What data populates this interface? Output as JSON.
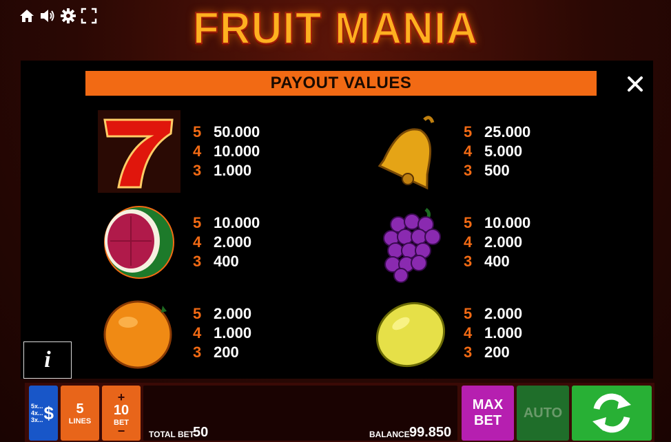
{
  "header": {
    "logo_text": "FRUIT MANIA",
    "icons": [
      "home-icon",
      "speaker-icon",
      "gear-icon",
      "fullscreen-icon"
    ]
  },
  "paytable": {
    "title": "PAYOUT VALUES",
    "symbols": [
      {
        "name": "seven",
        "rows": [
          {
            "count": "5",
            "value": "50.000"
          },
          {
            "count": "4",
            "value": "10.000"
          },
          {
            "count": "3",
            "value": "1.000"
          }
        ]
      },
      {
        "name": "bell",
        "rows": [
          {
            "count": "5",
            "value": "25.000"
          },
          {
            "count": "4",
            "value": "5.000"
          },
          {
            "count": "3",
            "value": "500"
          }
        ]
      },
      {
        "name": "watermelon",
        "rows": [
          {
            "count": "5",
            "value": "10.000"
          },
          {
            "count": "4",
            "value": "2.000"
          },
          {
            "count": "3",
            "value": "400"
          }
        ]
      },
      {
        "name": "grapes",
        "rows": [
          {
            "count": "5",
            "value": "10.000"
          },
          {
            "count": "4",
            "value": "2.000"
          },
          {
            "count": "3",
            "value": "400"
          }
        ]
      },
      {
        "name": "orange",
        "rows": [
          {
            "count": "5",
            "value": "2.000"
          },
          {
            "count": "4",
            "value": "1.000"
          },
          {
            "count": "3",
            "value": "200"
          }
        ]
      },
      {
        "name": "lemon",
        "rows": [
          {
            "count": "5",
            "value": "2.000"
          },
          {
            "count": "4",
            "value": "1.000"
          },
          {
            "count": "3",
            "value": "200"
          }
        ]
      }
    ],
    "info_label": "i"
  },
  "controls": {
    "paytable_lines": [
      "5x...",
      "4x...",
      "3x..."
    ],
    "paytable_symbol": "$",
    "lines_value": "5",
    "lines_label": "LINES",
    "bet_plus": "+",
    "bet_value": "10",
    "bet_label": "BET",
    "bet_minus": "−",
    "total_bet_label": "TOTAL BET",
    "total_bet_value": "50",
    "balance_label": "BALANCE",
    "balance_value": "99.850",
    "max_bet_line1": "MAX",
    "max_bet_line2": "BET",
    "auto_label": "AUTO"
  },
  "colors": {
    "accent_orange": "#f26a14",
    "max_bet_purple": "#b61fb0",
    "auto_green": "#1f6e2a",
    "spin_green": "#28b035",
    "paytable_blue": "#1856c8"
  }
}
